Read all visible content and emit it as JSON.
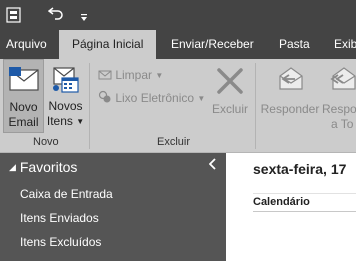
{
  "qat": {
    "icons": [
      "outlook-send-receive-icon",
      "undo-icon",
      "customize-qat-icon"
    ]
  },
  "tabs": [
    {
      "label": "Arquivo",
      "active": false
    },
    {
      "label": "Página Inicial",
      "active": true
    },
    {
      "label": "Enviar/Receber",
      "active": false
    },
    {
      "label": "Pasta",
      "active": false
    },
    {
      "label": "Exibi",
      "active": false
    }
  ],
  "ribbon": {
    "novo": {
      "new_email_line1": "Novo",
      "new_email_line2": "Email",
      "new_items_line1": "Novos",
      "new_items_line2": "Itens",
      "group_label": "Novo"
    },
    "excluir": {
      "limpar": "Limpar",
      "lixo": "Lixo Eletrônico",
      "excluir": "Excluir",
      "group_label": "Excluir"
    },
    "responder": {
      "responder": "Responder",
      "responder_todos_line1": "Respo",
      "responder_todos_line2": "a To"
    }
  },
  "sidebar": {
    "header": "Favoritos",
    "collapse_icon": "chevron-left-icon",
    "folders": [
      "Caixa de Entrada",
      "Itens Enviados",
      "Itens Excluídos"
    ]
  },
  "main": {
    "date": "sexta-feira, 17",
    "calendar_label": "Calendário"
  },
  "colors": {
    "title_bar": "#444444",
    "ribbon": "#cccccc",
    "sidebar": "#555555",
    "content": "#ffffff",
    "outlook_blue": "#1e5aa8"
  }
}
